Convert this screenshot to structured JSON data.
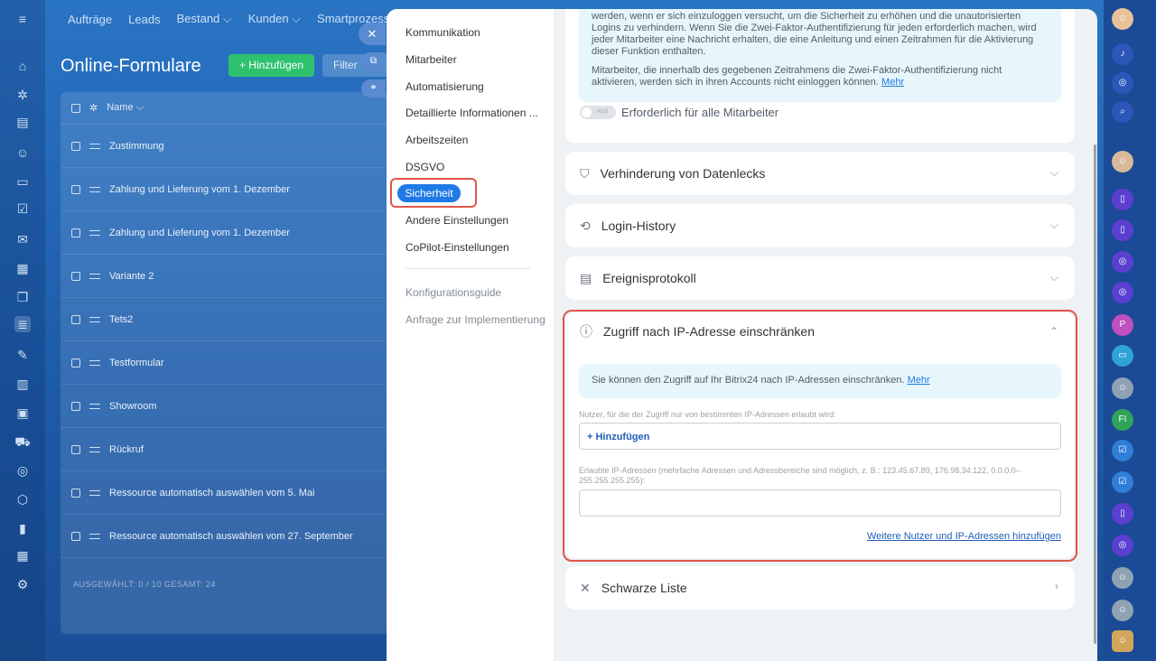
{
  "background": {
    "top_nav": [
      "Aufträge",
      "Leads",
      "Bestand ⌵",
      "Kunden ⌵",
      "Smartprozesse ⌵"
    ],
    "title": "Online-Formulare",
    "add_button": "+ Hinzufügen",
    "filter_label": "Filter",
    "table_header": "Name ⌵",
    "rows": [
      "Zustimmung",
      "Zahlung und Lieferung vom 1. Dezember",
      "Zahlung und Lieferung vom 1. Dezember",
      "Variante 2",
      "Tets2",
      "Testformular",
      "Showroom",
      "Rückruf",
      "Ressource automatisch auswählen vom 5. Mai",
      "Ressource automatisch auswählen vom 27. September"
    ],
    "footer": "AUSGEWÄHLT: 0 / 10    GESAMT: 24"
  },
  "menu": {
    "items": [
      "Kommunikation",
      "Mitarbeiter",
      "Automatisierung",
      "Detaillierte Informationen ...",
      "Arbeitszeiten",
      "DSGVO",
      "Sicherheit",
      "Andere Einstellungen",
      "CoPilot-Einstellungen"
    ],
    "secondary": [
      "Konfigurationsguide",
      "Anfrage zur Implementierung"
    ]
  },
  "twofa": {
    "text1": "werden, wenn er sich einzuloggen versucht, um die Sicherheit zu erhöhen und die unautorisierten Logins zu verhindern. Wenn Sie die Zwei-Faktor-Authentifizierung für jeden erforderlich machen, wird jeder Mitarbeiter eine Nachricht erhalten, die eine Anleitung und einen Zeitrahmen für die Aktivierung dieser Funktion enthalten.",
    "text2": "Mitarbeiter, die innerhalb des gegebenen Zeitrahmens die Zwei-Faktor-Authentifizierung nicht aktivieren, werden sich in ihren Accounts nicht einloggen können.",
    "more": "Mehr",
    "toggle_text": "AUS",
    "toggle_label": "Erforderlich für alle Mitarbeiter"
  },
  "sections": {
    "leak": "Verhinderung von Datenlecks",
    "login": "Login-History",
    "events": "Ereignisprotokoll",
    "ip": "Zugriff nach IP-Adresse einschränken",
    "blacklist": "Schwarze Liste"
  },
  "ip": {
    "info": "Sie können den Zugriff auf Ihr Bitrix24 nach IP-Adressen einschränken.",
    "info_more": "Mehr",
    "users_label": "Nutzer, für die der Zugriff nur von bestimmten IP-Adressen erlaubt wird:",
    "add_link": "+ Hinzufügen",
    "allowed_label": "Erlaubte IP-Adressen (mehrfache Adressen und Adressbereiche sind möglich, z. B.: 123.45.67.89, 176.98.34.122, 0.0.0.0–255.255.255.255):",
    "more_link": "Weitere Nutzer und IP-Adressen hinzufügen"
  },
  "colors": {
    "accent": "#1f79e6",
    "highlight": "#e0564a",
    "info_bg": "#e6f6fb"
  }
}
